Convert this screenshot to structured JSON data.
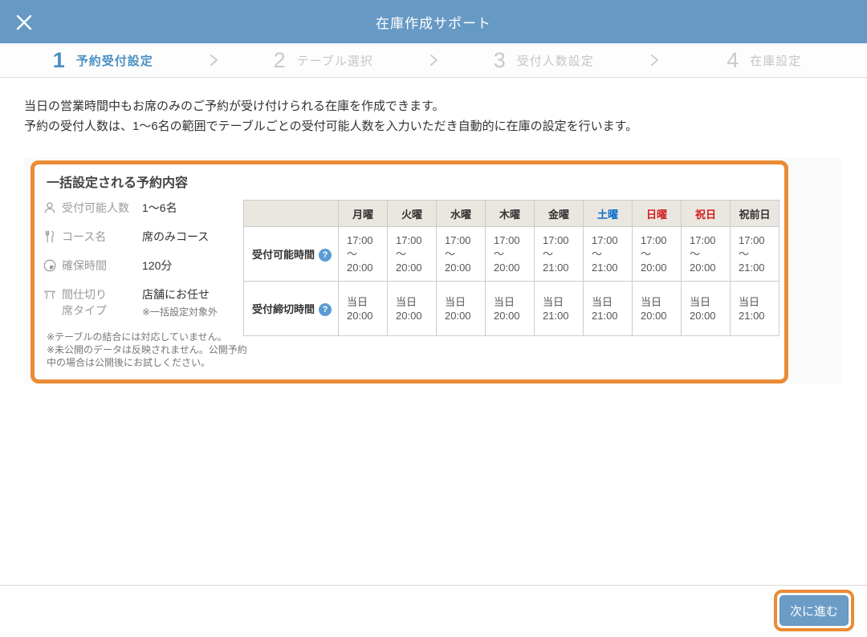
{
  "header": {
    "title": "在庫作成サポート"
  },
  "stepper": {
    "steps": [
      {
        "number": "1",
        "label": "予約受付設定",
        "active": true
      },
      {
        "number": "2",
        "label": "テーブル選択",
        "active": false
      },
      {
        "number": "3",
        "label": "受付人数設定",
        "active": false
      },
      {
        "number": "4",
        "label": "在庫設定",
        "active": false
      }
    ]
  },
  "description": {
    "line1": "当日の営業時間中もお席のみのご予約が受け付けられる在庫を作成できます。",
    "line2": "予約の受付人数は、1〜6名の範囲でテーブルごとの受付可能人数を入力いただき自動的に在庫の設定を行います。"
  },
  "panel": {
    "title": "一括設定される予約内容",
    "info": [
      {
        "icon": "person-icon",
        "label": "受付可能人数",
        "value": "1〜6名"
      },
      {
        "icon": "cutlery-icon",
        "label": "コース名",
        "value": "席のみコース"
      },
      {
        "icon": "clock-icon",
        "label": "確保時間",
        "value": "120分"
      },
      {
        "icon": "table-icon",
        "label": "間仕切り\n席タイプ",
        "value": "店舗にお任せ",
        "note": "※一括設定対象外"
      }
    ],
    "notes": {
      "line1": "※テーブルの結合には対応していません。",
      "line2": "※未公開のデータは反映されません。公開予約中の場合は公開後にお試しください。"
    },
    "table": {
      "columns": [
        {
          "label": ""
        },
        {
          "label": "月曜"
        },
        {
          "label": "火曜"
        },
        {
          "label": "水曜"
        },
        {
          "label": "木曜"
        },
        {
          "label": "金曜"
        },
        {
          "label": "土曜"
        },
        {
          "label": "日曜"
        },
        {
          "label": "祝日"
        },
        {
          "label": "祝前日"
        }
      ],
      "rows": [
        {
          "label": "受付可能時間",
          "help_icon": "?",
          "cells": [
            "17:00\n〜\n20:00",
            "17:00\n〜\n20:00",
            "17:00\n〜\n20:00",
            "17:00\n〜\n20:00",
            "17:00\n〜\n21:00",
            "17:00\n〜\n21:00",
            "17:00\n〜\n20:00",
            "17:00\n〜\n20:00",
            "17:00\n〜\n21:00"
          ]
        },
        {
          "label": "受付締切時間",
          "help_icon": "?",
          "cells": [
            "当日\n20:00",
            "当日\n20:00",
            "当日\n20:00",
            "当日\n20:00",
            "当日\n21:00",
            "当日\n21:00",
            "当日\n20:00",
            "当日\n20:00",
            "当日\n21:00"
          ]
        }
      ]
    }
  },
  "footer": {
    "next_label": "次に進む"
  },
  "colors": {
    "header_bg": "#6799c5",
    "active_step": "#4a90c2",
    "highlight_orange": "#ea8b35",
    "saturday": "#0b6bcb",
    "sunday_holiday": "#d21e1e",
    "table_header_bg": "#eae7e0",
    "button_bg": "#6b9cc6"
  }
}
